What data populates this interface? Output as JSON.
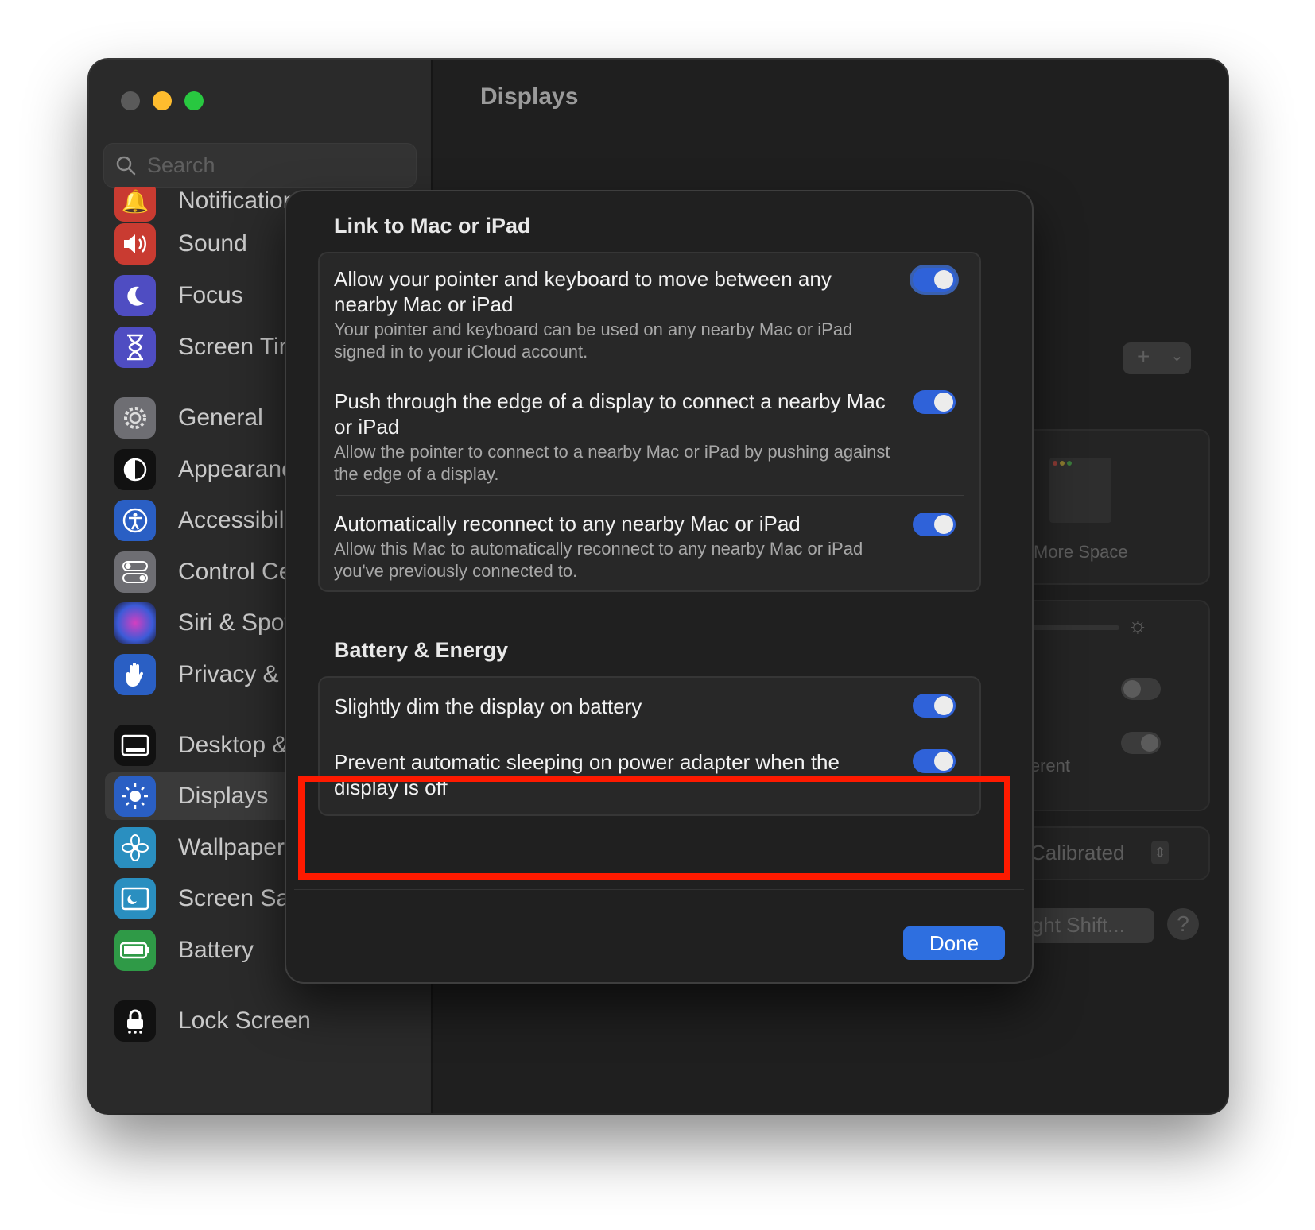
{
  "window": {
    "title": "Displays"
  },
  "search": {
    "placeholder": "Search"
  },
  "sidebar": {
    "items": [
      {
        "label": "Notifications",
        "icon": "bell-icon",
        "color": "#e5483c"
      },
      {
        "label": "Sound",
        "icon": "speaker-icon",
        "color": "#e5483c"
      },
      {
        "label": "Focus",
        "icon": "moon-icon",
        "color": "#5e5ce6"
      },
      {
        "label": "Screen Time",
        "icon": "hourglass-icon",
        "color": "#5e5ce6"
      },
      {
        "label": "General",
        "icon": "gear-icon",
        "color": "#8e8e93"
      },
      {
        "label": "Appearance",
        "icon": "appearance-icon",
        "color": "#1c1c1e"
      },
      {
        "label": "Accessibility",
        "icon": "accessibility-icon",
        "color": "#2f6fe0"
      },
      {
        "label": "Control Centre",
        "icon": "toggles-icon",
        "color": "#8e8e93"
      },
      {
        "label": "Siri & Spotlight",
        "icon": "siri-icon",
        "color": "#4b3b8f"
      },
      {
        "label": "Privacy & Security",
        "icon": "hand-icon",
        "color": "#2f6fe0"
      },
      {
        "label": "Desktop & Dock",
        "icon": "dock-icon",
        "color": "#1c1c1e"
      },
      {
        "label": "Displays",
        "icon": "sun-icon",
        "color": "#2f6fe0"
      },
      {
        "label": "Wallpaper",
        "icon": "flower-icon",
        "color": "#2fa3d8"
      },
      {
        "label": "Screen Saver",
        "icon": "screensaver-icon",
        "color": "#2fa3d8"
      },
      {
        "label": "Battery",
        "icon": "battery-icon",
        "color": "#34a853"
      },
      {
        "label": "Lock Screen",
        "icon": "lock-icon",
        "color": "#1c1c1e"
      }
    ]
  },
  "background": {
    "add_label": "+",
    "more_space": "More Space",
    "different_fragment": "fferent",
    "calibrated": "Calibrated",
    "night_shift": "ight Shift...",
    "help": "?"
  },
  "dialog": {
    "link_section_title": "Link to Mac or iPad",
    "link_rows": [
      {
        "title": "Allow your pointer and keyboard to move between any nearby Mac or iPad",
        "desc": "Your pointer and keyboard can be used on any nearby Mac or iPad signed in to your iCloud account.",
        "on": true
      },
      {
        "title": "Push through the edge of a display to connect a nearby Mac or iPad",
        "desc": "Allow the pointer to connect to a nearby Mac or iPad by pushing against the edge of a display.",
        "on": true
      },
      {
        "title": "Automatically reconnect to any nearby Mac or iPad",
        "desc": "Allow this Mac to automatically reconnect to any nearby Mac or iPad you've previously connected to.",
        "on": true
      }
    ],
    "battery_section_title": "Battery & Energy",
    "battery_rows": [
      {
        "title": "Slightly dim the display on battery",
        "on": true
      },
      {
        "title": "Prevent automatic sleeping on power adapter when the display is off",
        "on": true
      }
    ],
    "done_label": "Done",
    "accent_color": "#2f62d9",
    "highlight_color": "#ff1a00"
  }
}
